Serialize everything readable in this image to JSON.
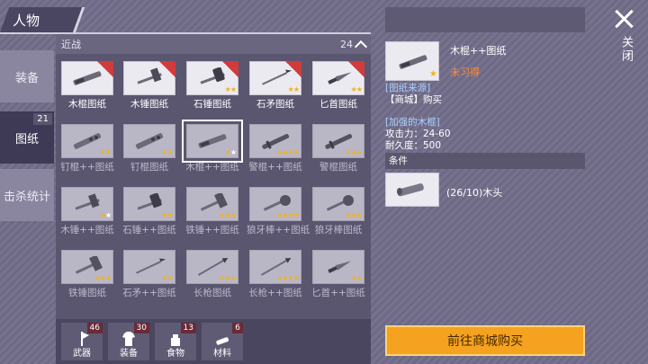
{
  "header": {
    "title": "人物"
  },
  "tabs": [
    {
      "label": "装备",
      "active": false,
      "badge": ""
    },
    {
      "label": "图纸",
      "active": true,
      "badge": "21"
    },
    {
      "label": "击杀统计",
      "active": false,
      "badge": ""
    }
  ],
  "panel": {
    "category": "近战",
    "count": "24"
  },
  "items": [
    {
      "label": "木棍图纸",
      "icon": "stick-icon",
      "stars": 0,
      "new": true,
      "dim": false
    },
    {
      "label": "木锤图纸",
      "icon": "hammer-icon",
      "stars": 0,
      "new": true,
      "dim": false
    },
    {
      "label": "石锤图纸",
      "icon": "stone-hammer-icon",
      "stars": 2,
      "new": true,
      "dim": false
    },
    {
      "label": "石矛图纸",
      "icon": "spear-icon",
      "stars": 2,
      "new": true,
      "dim": false
    },
    {
      "label": "匕首图纸",
      "icon": "dagger-icon",
      "stars": 2,
      "new": true,
      "dim": false
    },
    {
      "label": "钉棍++图纸",
      "icon": "spiked-club-icon",
      "stars": 2,
      "new": false,
      "dim": true
    },
    {
      "label": "钉棍图纸",
      "icon": "spiked-club-icon",
      "stars": 2,
      "new": false,
      "dim": true
    },
    {
      "label": "木棍++图纸",
      "icon": "stick-icon",
      "stars": 1,
      "new": false,
      "dim": true,
      "selected": true
    },
    {
      "label": "警棍++图纸",
      "icon": "baton-icon",
      "stars": 4,
      "new": false,
      "dim": true
    },
    {
      "label": "警棍图纸",
      "icon": "baton-icon",
      "stars": 3,
      "new": false,
      "dim": true
    },
    {
      "label": "木锤++图纸",
      "icon": "hammer-icon",
      "stars": 1,
      "new": false,
      "dim": true
    },
    {
      "label": "石锤++图纸",
      "icon": "stone-hammer-icon",
      "stars": 2,
      "new": false,
      "dim": true
    },
    {
      "label": "铁锤++图纸",
      "icon": "iron-hammer-icon",
      "stars": 3,
      "new": false,
      "dim": true
    },
    {
      "label": "狼牙棒++图纸",
      "icon": "mace-icon",
      "stars": 4,
      "new": false,
      "dim": true
    },
    {
      "label": "狼牙棒图纸",
      "icon": "mace-icon",
      "stars": 3,
      "new": false,
      "dim": true
    },
    {
      "label": "铁锤图纸",
      "icon": "iron-hammer-icon",
      "stars": 3,
      "new": false,
      "dim": true
    },
    {
      "label": "石矛++图纸",
      "icon": "spear-icon",
      "stars": 2,
      "new": false,
      "dim": true
    },
    {
      "label": "长枪图纸",
      "icon": "lance-icon",
      "stars": 3,
      "new": false,
      "dim": true
    },
    {
      "label": "长枪++图纸",
      "icon": "lance-icon",
      "stars": 4,
      "new": false,
      "dim": true
    },
    {
      "label": "匕首++图纸",
      "icon": "dagger-icon",
      "stars": 2,
      "new": false,
      "dim": true
    }
  ],
  "categories": [
    {
      "label": "武器",
      "count": "46",
      "icon": "axe-icon"
    },
    {
      "label": "装备",
      "count": "30",
      "icon": "shirt-icon"
    },
    {
      "label": "食物",
      "count": "13",
      "icon": "food-icon"
    },
    {
      "label": "材料",
      "count": "6",
      "icon": "material-icon"
    }
  ],
  "detail": {
    "name": "木棍++图纸",
    "status": "未习得",
    "source_title": "[图纸来源]",
    "source": "【商城】购买",
    "item_title": "[加强的木棍]",
    "attack": "攻击力：24-60",
    "durability": "耐久度：500",
    "conditions_label": "条件",
    "material": "(26/10)木头",
    "shop_button": "前往商城购买"
  },
  "close_label": "关闭",
  "colors": {
    "star": "#f2b21c",
    "shop_button": "#f4a21f",
    "new_badge": "#d23b3b",
    "status": "#ff8a3c"
  }
}
